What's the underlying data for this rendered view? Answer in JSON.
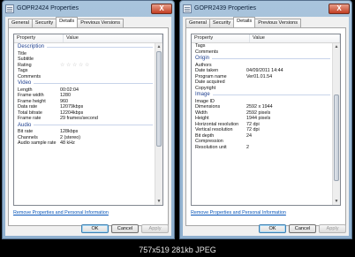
{
  "left": {
    "title": "GOPR2424 Properties",
    "close_label": "X",
    "tabs": [
      "General",
      "Security",
      "Details",
      "Previous Versions"
    ],
    "header": {
      "property": "Property",
      "value": "Value"
    },
    "rows": [
      {
        "section": "Description"
      },
      {
        "p": "Title",
        "v": ""
      },
      {
        "p": "Subtitle",
        "v": ""
      },
      {
        "p": "Rating",
        "stars": 5
      },
      {
        "p": "Tags",
        "v": ""
      },
      {
        "p": "Comments",
        "v": ""
      },
      {
        "section": "Video"
      },
      {
        "p": "Length",
        "v": "00:02:04"
      },
      {
        "p": "Frame width",
        "v": "1280"
      },
      {
        "p": "Frame height",
        "v": "960"
      },
      {
        "p": "Data rate",
        "v": "12079kbps"
      },
      {
        "p": "Total bitrate",
        "v": "12204kbps"
      },
      {
        "p": "Frame rate",
        "v": "29 frames/second"
      },
      {
        "section": "Audio"
      },
      {
        "p": "Bit rate",
        "v": "128kbps"
      },
      {
        "p": "Channels",
        "v": "2 (stereo)"
      },
      {
        "p": "Audio sample rate",
        "v": "48 kHz"
      }
    ],
    "link": "Remove Properties and Personal Information",
    "buttons": {
      "ok": "OK",
      "cancel": "Cancel",
      "apply": "Apply"
    }
  },
  "right": {
    "title": "GOPR2439 Properties",
    "close_label": "X",
    "tabs": [
      "General",
      "Security",
      "Details",
      "Previous Versions"
    ],
    "header": {
      "property": "Property",
      "value": "Value"
    },
    "rows": [
      {
        "p": "Tags",
        "v": ""
      },
      {
        "p": "Comments",
        "v": ""
      },
      {
        "section": "Origin"
      },
      {
        "p": "Authors",
        "v": ""
      },
      {
        "p": "Date taken",
        "v": "04/09/2011 14:44"
      },
      {
        "p": "Program name",
        "v": "Ver01.01.54"
      },
      {
        "p": "Date acquired",
        "v": ""
      },
      {
        "p": "Copyright",
        "v": ""
      },
      {
        "section": "Image"
      },
      {
        "p": "Image ID",
        "v": ""
      },
      {
        "p": "Dimensions",
        "v": "2592 x 1944"
      },
      {
        "p": "Width",
        "v": "2592 pixels"
      },
      {
        "p": "Height",
        "v": "1944 pixels"
      },
      {
        "p": "Horizontal resolution",
        "v": "72 dpi"
      },
      {
        "p": "Vertical resolution",
        "v": "72 dpi"
      },
      {
        "p": "Bit depth",
        "v": "24"
      },
      {
        "p": "Compression",
        "v": ""
      },
      {
        "p": "Resolution unit",
        "v": "2"
      }
    ],
    "link": "Remove Properties and Personal Information",
    "buttons": {
      "ok": "OK",
      "cancel": "Cancel",
      "apply": "Apply"
    }
  },
  "caption": "757x519 281kb JPEG"
}
